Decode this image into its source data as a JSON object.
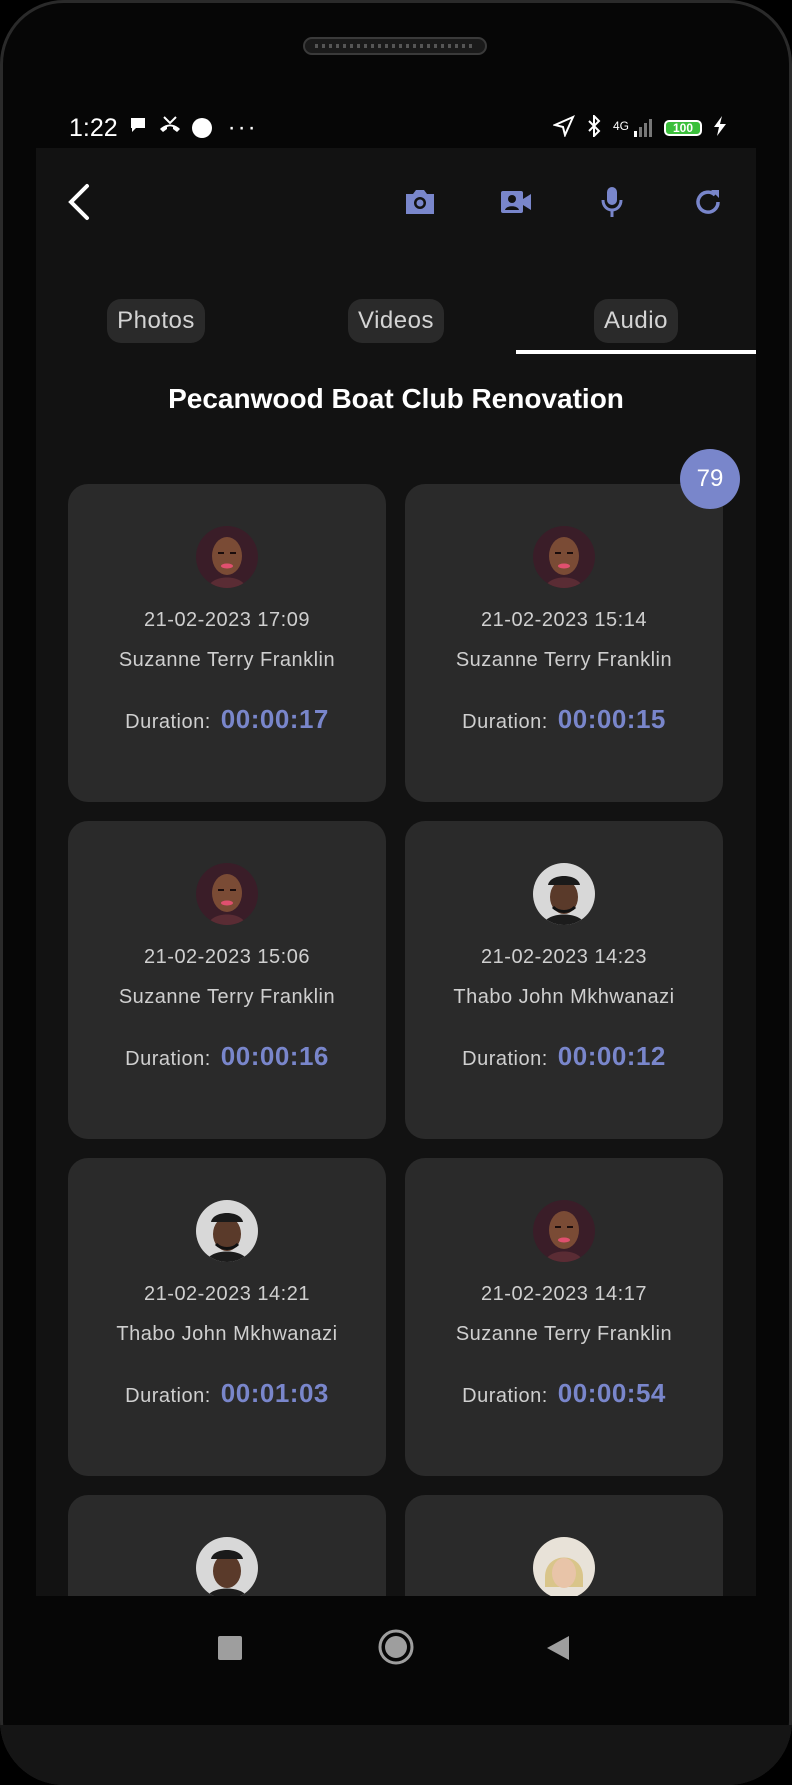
{
  "status_bar": {
    "time": "1:22",
    "network": "4G",
    "battery": "100"
  },
  "toolbar": {
    "back_icon": "chevron-left-icon",
    "camera_icon": "camera-icon",
    "video_icon": "video-camera-icon",
    "mic_icon": "microphone-icon",
    "refresh_icon": "refresh-icon"
  },
  "tabs": [
    {
      "label": "Photos"
    },
    {
      "label": "Videos"
    },
    {
      "label": "Audio"
    }
  ],
  "active_tab": "Audio",
  "project_title": "Pecanwood Boat Club Renovation",
  "count_badge": "79",
  "colors": {
    "accent": "#7986cb",
    "background": "#121212",
    "card": "#2a2a2a"
  },
  "recordings": [
    {
      "date": "21-02-2023 17:09",
      "name": "Suzanne Terry Franklin",
      "duration_label": "Duration:",
      "duration": "00:00:17"
    },
    {
      "date": "21-02-2023 15:14",
      "name": "Suzanne Terry Franklin",
      "duration_label": "Duration:",
      "duration": "00:00:15"
    },
    {
      "date": "21-02-2023 15:06",
      "name": "Suzanne Terry Franklin",
      "duration_label": "Duration:",
      "duration": "00:00:16"
    },
    {
      "date": "21-02-2023 14:23",
      "name": "Thabo John Mkhwanazi",
      "duration_label": "Duration:",
      "duration": "00:00:12"
    },
    {
      "date": "21-02-2023 14:21",
      "name": "Thabo John Mkhwanazi",
      "duration_label": "Duration:",
      "duration": "00:01:03"
    },
    {
      "date": "21-02-2023 14:17",
      "name": "Suzanne Terry Franklin",
      "duration_label": "Duration:",
      "duration": "00:00:54"
    },
    {
      "date": "",
      "name": "",
      "duration_label": "",
      "duration": ""
    },
    {
      "date": "",
      "name": "",
      "duration_label": "",
      "duration": ""
    }
  ]
}
